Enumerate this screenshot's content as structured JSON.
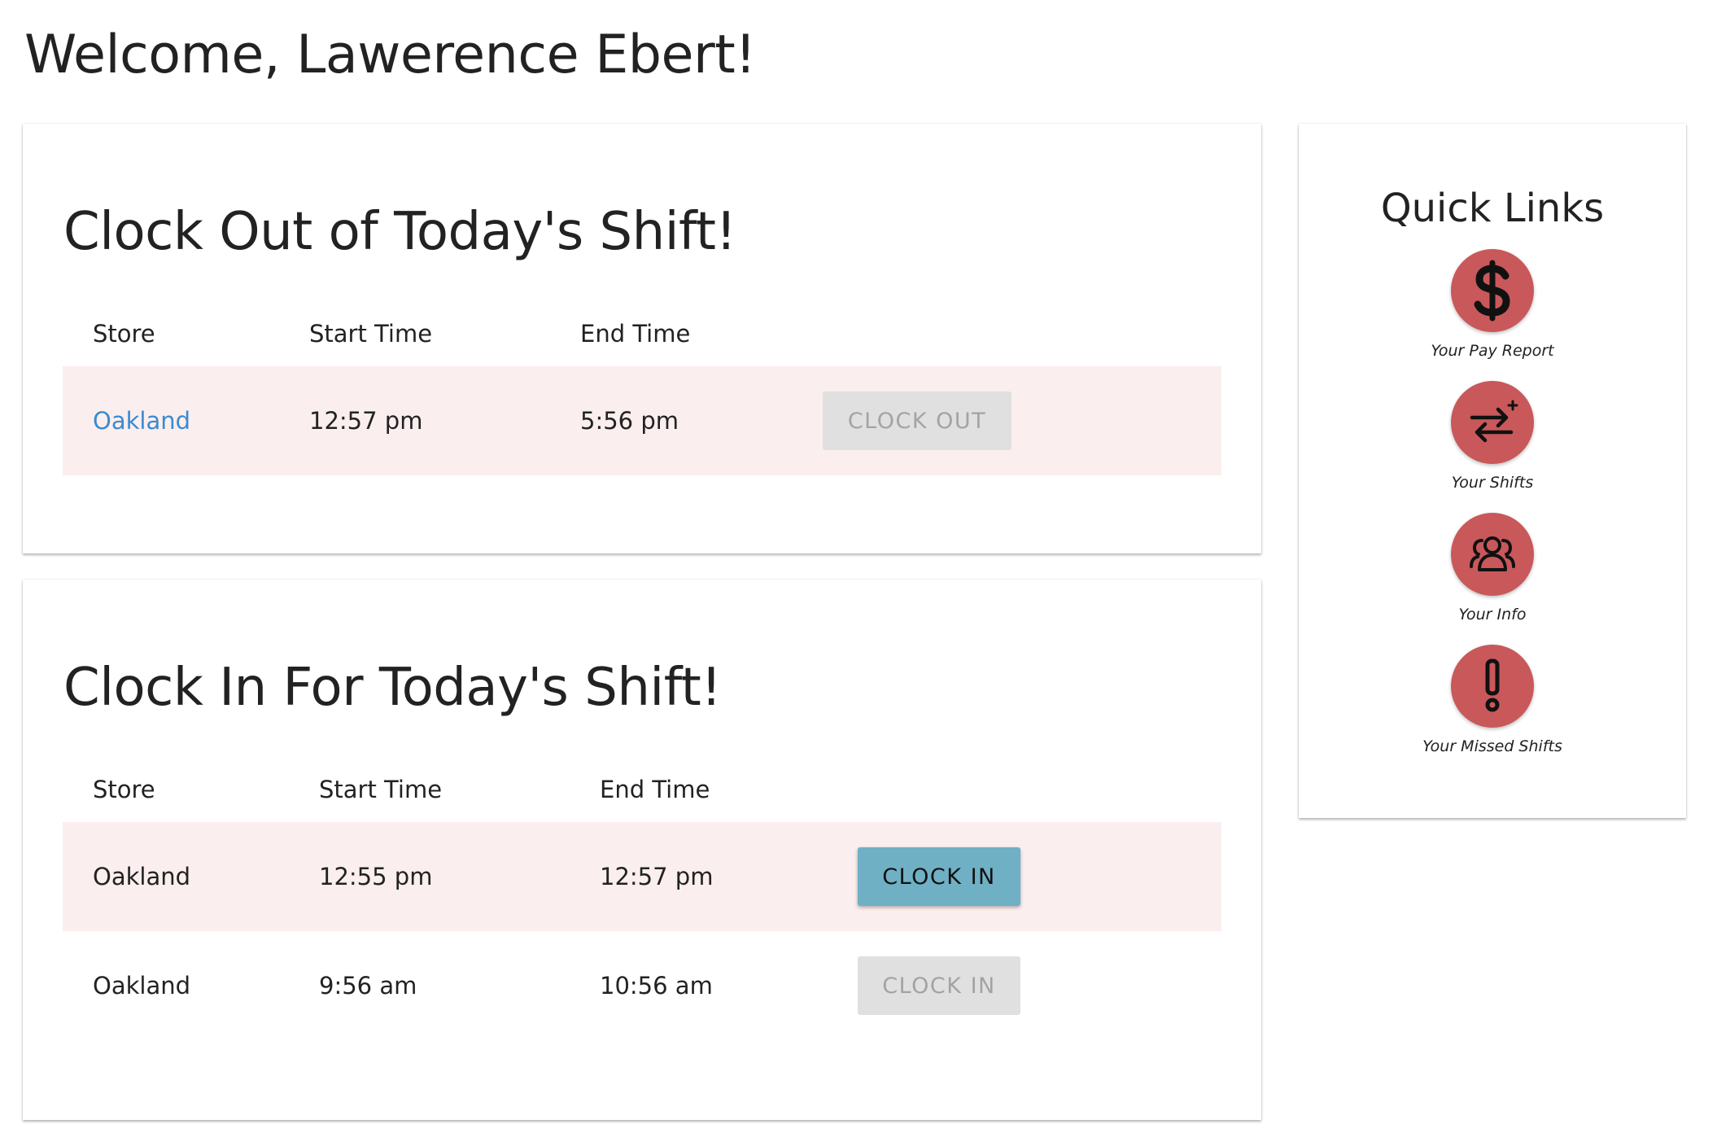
{
  "welcome": "Welcome, Lawerence Ebert!",
  "clock_out": {
    "title": "Clock Out of Today's Shift!",
    "headers": {
      "store": "Store",
      "start": "Start Time",
      "end": "End Time"
    },
    "rows": [
      {
        "store": "Oakland",
        "start": "12:57 pm",
        "end": "5:56 pm",
        "button": "CLOCK OUT",
        "enabled": false,
        "store_is_link": true
      }
    ]
  },
  "clock_in": {
    "title": "Clock In For Today's Shift!",
    "headers": {
      "store": "Store",
      "start": "Start Time",
      "end": "End Time"
    },
    "rows": [
      {
        "store": "Oakland",
        "start": "12:55 pm",
        "end": "12:57 pm",
        "button": "CLOCK IN",
        "enabled": true
      },
      {
        "store": "Oakland",
        "start": "9:56 am",
        "end": "10:56 am",
        "button": "CLOCK IN",
        "enabled": false
      }
    ]
  },
  "quick_links": {
    "title": "Quick Links",
    "items": [
      {
        "label": "Your Pay Report",
        "icon": "dollar-icon"
      },
      {
        "label": "Your Shifts",
        "icon": "swap-arrows-icon"
      },
      {
        "label": "Your Info",
        "icon": "people-icon"
      },
      {
        "label": "Your Missed Shifts",
        "icon": "exclamation-icon"
      }
    ]
  },
  "colors": {
    "accent_red": "#c9585a",
    "row_highlight": "#fbeeee",
    "link_blue": "#3a8bd0",
    "button_active": "#6fb0c4",
    "button_disabled": "#e0e0e0"
  }
}
